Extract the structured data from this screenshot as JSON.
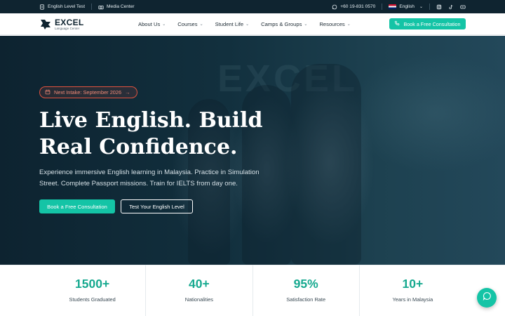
{
  "topbar": {
    "level_test": "English Level Test",
    "media_center": "Media Center",
    "phone": "+60 19-831 0570",
    "language": "English",
    "icons": [
      "document-icon",
      "camera-icon",
      "whatsapp-icon",
      "uk-flag-icon",
      "instagram-icon",
      "tiktok-icon",
      "youtube-icon"
    ]
  },
  "nav": {
    "logo_name": "EXCEL",
    "logo_sub": "Language Center",
    "menu": [
      {
        "label": "About Us"
      },
      {
        "label": "Courses"
      },
      {
        "label": "Student Life"
      },
      {
        "label": "Camps & Groups"
      },
      {
        "label": "Resources"
      }
    ],
    "cta": "Book a Free Consultation"
  },
  "hero": {
    "badge": "Next Intake: September 2026",
    "title_line1": "Live English. Build",
    "title_line2": "Real Confidence.",
    "subtitle": "Experience immersive English learning in Malaysia. Practice in Simulation Street. Complete Passport missions. Train for IELTS from day one.",
    "primary_button": "Book a Free Consultation",
    "secondary_button": "Test Your English Level"
  },
  "stats": [
    {
      "value": "1500+",
      "label": "Students Graduated"
    },
    {
      "value": "40+",
      "label": "Nationalities"
    },
    {
      "value": "95%",
      "label": "Satisfaction Rate"
    },
    {
      "value": "10+",
      "label": "Years in Malaysia"
    }
  ],
  "colors": {
    "accent": "#14c4a6",
    "stat_value": "#16a98f",
    "hero_dark": "#0d2330",
    "badge": "#e2533f"
  }
}
